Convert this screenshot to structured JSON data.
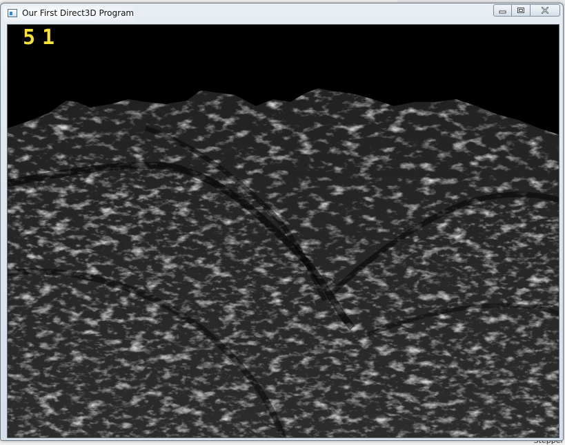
{
  "window": {
    "title": "Our First Direct3D Program"
  },
  "caption_buttons": {
    "minimize_icon": "minimize-icon",
    "maximize_icon": "maximize-icon",
    "close_icon": "close-icon"
  },
  "viewport": {
    "fps": "51",
    "scene": "3D terrain rendering",
    "background_color": "#000000",
    "fps_color": "#f6e03a"
  },
  "desktop": {
    "bottom_text": "Stepper"
  }
}
